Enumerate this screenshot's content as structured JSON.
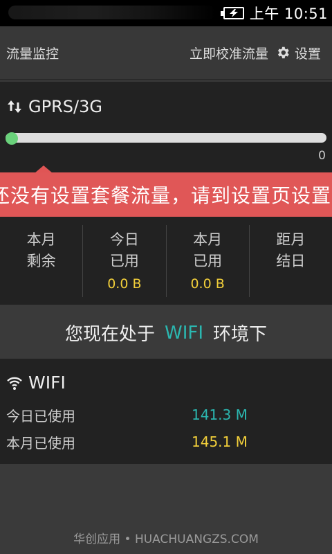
{
  "status_bar": {
    "time": "上午 10:51"
  },
  "header": {
    "title": "流量监控",
    "calibrate_label": "立即校准流量",
    "settings_label": "设置"
  },
  "gprs": {
    "title": "GPRS/3G",
    "progress_percent": 0,
    "progress_max_label": "0",
    "warning": "还没有设置套餐流量，请到设置页设置",
    "stats": [
      {
        "line1": "本月",
        "line2": "剩余",
        "value": ""
      },
      {
        "line1": "今日",
        "line2": "已用",
        "value": "0.0 B"
      },
      {
        "line1": "本月",
        "line2": "已用",
        "value": "0.0 B"
      },
      {
        "line1": "距月",
        "line2": "结日",
        "value": ""
      }
    ]
  },
  "wifi_notice": {
    "prefix": "您现在处于",
    "highlight": "WIFI",
    "suffix": "环境下"
  },
  "wifi": {
    "title": "WIFI",
    "today_label": "今日已使用",
    "today_value": "141.3 M",
    "month_label": "本月已使用",
    "month_value": "145.1 M"
  },
  "footer": {
    "text": "华创应用 • HUACHUANGZS.COM"
  },
  "colors": {
    "accent_teal": "#2bb7b0",
    "value_yellow": "#f2cf3a",
    "warning_red": "#e05757",
    "progress_green": "#66cc77"
  },
  "icons": [
    "battery-charging-icon",
    "gear-icon",
    "up-down-arrows-icon",
    "wifi-icon"
  ]
}
